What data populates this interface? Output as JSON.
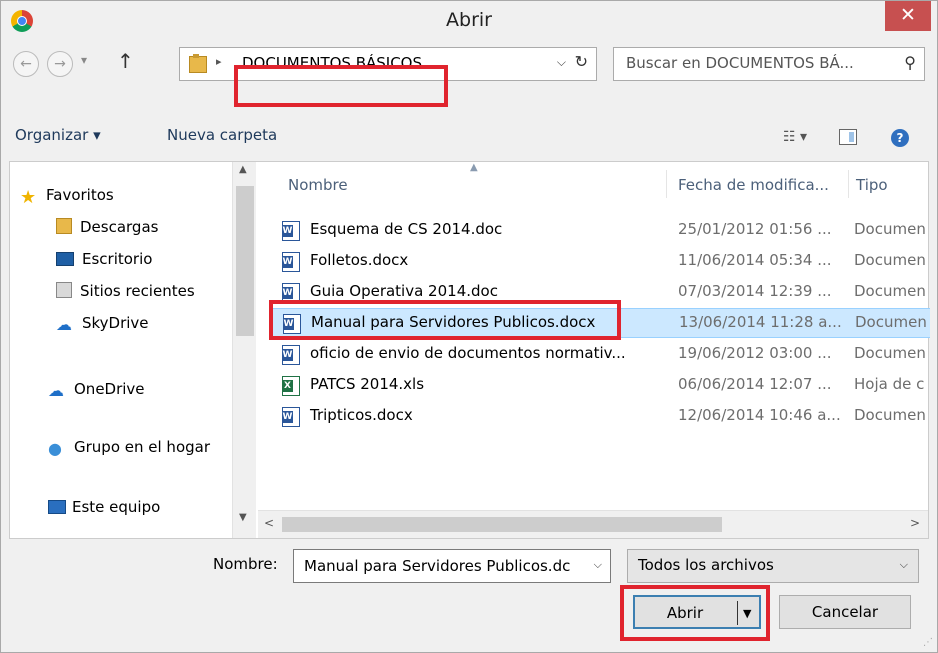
{
  "window": {
    "title": "Abrir",
    "close_glyph": "✕"
  },
  "navbar": {
    "back_glyph": "←",
    "forward_glyph": "→",
    "up_glyph": "↑",
    "address": "DOCUMENTOS BÁSICOS",
    "search_placeholder": "Buscar en DOCUMENTOS BÁ..."
  },
  "toolbar": {
    "organize": "Organizar ▾",
    "new_folder": "Nueva carpeta"
  },
  "sidebar": {
    "items": [
      {
        "label": "Favoritos",
        "icon": "star-icon"
      },
      {
        "label": "Descargas",
        "icon": "downloads-icon"
      },
      {
        "label": "Escritorio",
        "icon": "desktop-icon"
      },
      {
        "label": "Sitios recientes",
        "icon": "recent-places-icon"
      },
      {
        "label": "SkyDrive",
        "icon": "skydrive-icon"
      },
      {
        "label": "OneDrive",
        "icon": "onedrive-icon"
      },
      {
        "label": "Grupo en el hogar",
        "icon": "homegroup-icon"
      },
      {
        "label": "Este equipo",
        "icon": "computer-icon"
      }
    ]
  },
  "columns": {
    "name": "Nombre",
    "date": "Fecha de modifica...",
    "type": "Tipo"
  },
  "files": [
    {
      "name": "Esquema de CS 2014.doc",
      "date": "25/01/2012 01:56 ...",
      "type": "Documen",
      "icon": "word-doc-icon"
    },
    {
      "name": "Folletos.docx",
      "date": "11/06/2014 05:34 ...",
      "type": "Documen",
      "icon": "word-docx-icon"
    },
    {
      "name": "Guia Operativa 2014.doc",
      "date": "07/03/2014 12:39 ...",
      "type": "Documen",
      "icon": "word-doc-icon"
    },
    {
      "name": "Manual para Servidores Publicos.docx",
      "date": "13/06/2014 11:28 a...",
      "type": "Documen",
      "icon": "word-docx-icon",
      "selected": true
    },
    {
      "name": "oficio de envio de documentos normativ...",
      "date": "19/06/2012 03:00 ...",
      "type": "Documen",
      "icon": "word-doc-icon"
    },
    {
      "name": "PATCS 2014.xls",
      "date": "06/06/2014 12:07 ...",
      "type": "Hoja de c",
      "icon": "excel-icon"
    },
    {
      "name": "Tripticos.docx",
      "date": "12/06/2014 10:46 a...",
      "type": "Documen",
      "icon": "word-docx-icon"
    }
  ],
  "footer": {
    "name_label": "Nombre:",
    "name_value": "Manual para Servidores Publicos.dc",
    "filter_value": "Todos los archivos",
    "open_label": "Abrir",
    "cancel_label": "Cancelar"
  },
  "colors": {
    "highlight": "#e0242e",
    "selection": "#cce8ff",
    "close": "#c75050"
  }
}
